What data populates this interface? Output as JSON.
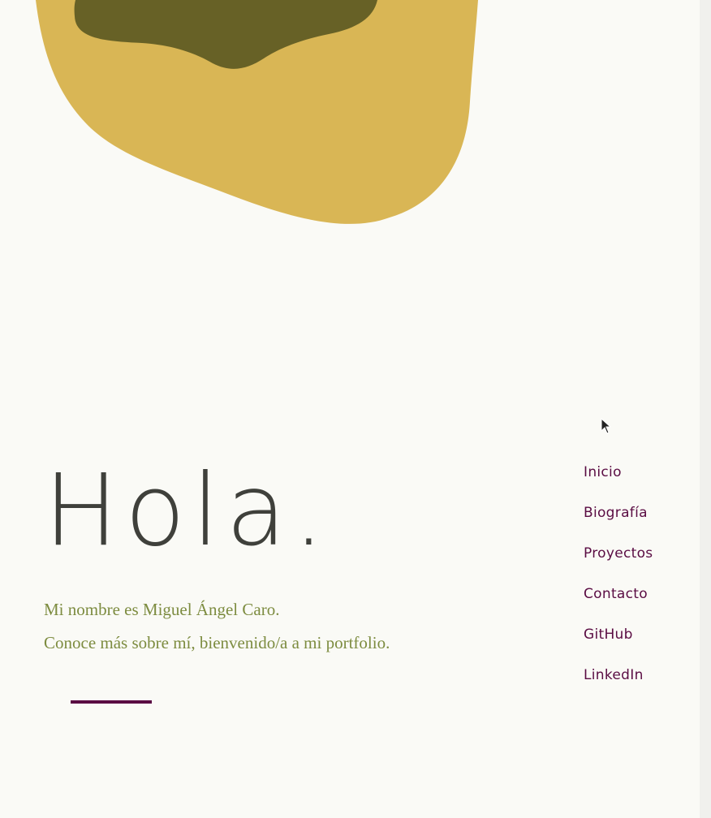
{
  "hero": {
    "title": "Hola.",
    "intro_line_1": "Mi nombre es Miguel Ángel Caro.",
    "intro_line_2": "Conoce más sobre mí, bienvenido/a a mi portfolio."
  },
  "nav": {
    "items": [
      {
        "label": "Inicio"
      },
      {
        "label": "Biografía"
      },
      {
        "label": "Proyectos"
      },
      {
        "label": "Contacto"
      },
      {
        "label": "GitHub"
      },
      {
        "label": "LinkedIn"
      }
    ]
  },
  "colors": {
    "background": "#fafaf6",
    "blob_outer": "#d9b655",
    "blob_inner": "#676126",
    "title_text": "#3f403b",
    "intro_text": "#7d8c40",
    "accent": "#5a0c43"
  },
  "icons": {
    "cursor": "mouse-pointer-icon"
  }
}
